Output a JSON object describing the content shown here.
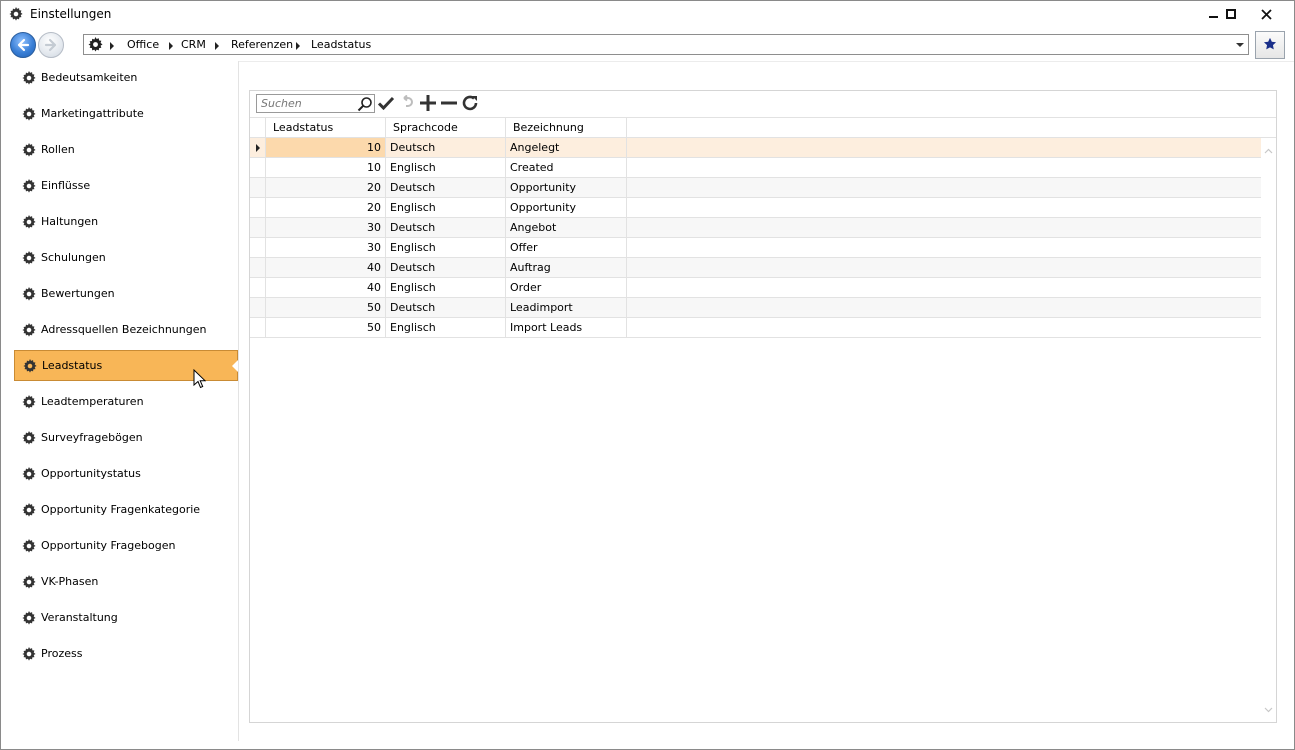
{
  "window": {
    "title": "Einstellungen",
    "icon": "gear-icon",
    "controls": [
      "minimize-icon",
      "maximize-icon",
      "close-icon"
    ]
  },
  "navigation": {
    "back_icon": "arrow-left-icon",
    "forward_icon": "arrow-right-icon",
    "breadcrumb": [
      "Office",
      "CRM",
      "Referenzen",
      "Leadstatus"
    ],
    "favorite_icon": "star-icon"
  },
  "sidebar": {
    "items": [
      {
        "label": "Bedeutsamkeiten"
      },
      {
        "label": "Marketingattribute"
      },
      {
        "label": "Rollen"
      },
      {
        "label": "Einflüsse"
      },
      {
        "label": "Haltungen"
      },
      {
        "label": "Schulungen"
      },
      {
        "label": "Bewertungen"
      },
      {
        "label": "Adressquellen Bezeichnungen"
      },
      {
        "label": "Leadstatus",
        "active": true
      },
      {
        "label": "Leadtemperaturen"
      },
      {
        "label": "Surveyfragebögen"
      },
      {
        "label": "Opportunitystatus"
      },
      {
        "label": "Opportunity Fragenkategorie"
      },
      {
        "label": "Opportunity Fragebogen"
      },
      {
        "label": "VK-Phasen"
      },
      {
        "label": "Veranstaltung"
      },
      {
        "label": "Prozess"
      }
    ],
    "active_color": "#f8b657"
  },
  "toolbar": {
    "search_placeholder": "Suchen",
    "buttons": [
      "checkmark-icon",
      "undo-icon",
      "plus-icon",
      "minus-icon",
      "refresh-icon"
    ]
  },
  "grid": {
    "columns": [
      "Leadstatus",
      "Sprachcode",
      "Bezeichnung"
    ],
    "rows": [
      {
        "leadstatus": "10",
        "sprachcode": "Deutsch",
        "bezeichnung": "Angelegt",
        "selected": true
      },
      {
        "leadstatus": "10",
        "sprachcode": "Englisch",
        "bezeichnung": "Created"
      },
      {
        "leadstatus": "20",
        "sprachcode": "Deutsch",
        "bezeichnung": "Opportunity"
      },
      {
        "leadstatus": "20",
        "sprachcode": "Englisch",
        "bezeichnung": "Opportunity"
      },
      {
        "leadstatus": "30",
        "sprachcode": "Deutsch",
        "bezeichnung": "Angebot"
      },
      {
        "leadstatus": "30",
        "sprachcode": "Englisch",
        "bezeichnung": "Offer"
      },
      {
        "leadstatus": "40",
        "sprachcode": "Deutsch",
        "bezeichnung": "Auftrag"
      },
      {
        "leadstatus": "40",
        "sprachcode": "Englisch",
        "bezeichnung": "Order"
      },
      {
        "leadstatus": "50",
        "sprachcode": "Deutsch",
        "bezeichnung": "Leadimport"
      },
      {
        "leadstatus": "50",
        "sprachcode": "Englisch",
        "bezeichnung": "Import Leads"
      }
    ],
    "selected_row_color": "#fdeede"
  }
}
